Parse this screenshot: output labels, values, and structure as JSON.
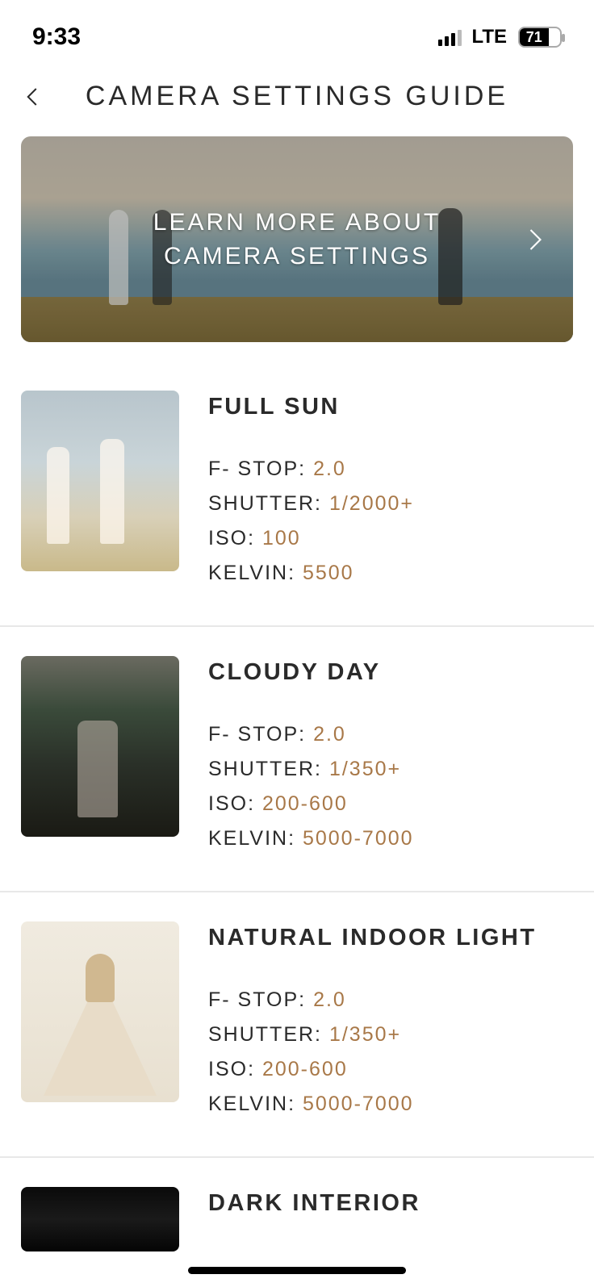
{
  "status": {
    "time": "9:33",
    "network": "LTE",
    "battery": "71"
  },
  "header": {
    "title": "CAMERA SETTINGS GUIDE"
  },
  "hero": {
    "line1": "LEARN MORE ABOUT",
    "line2": "CAMERA SETTINGS"
  },
  "specLabels": {
    "fstop": "F- STOP: ",
    "shutter": "SHUTTER: ",
    "iso": "ISO: ",
    "kelvin": "KELVIN: "
  },
  "entries": [
    {
      "title": "FULL SUN",
      "fstop": "2.0",
      "shutter": "1/2000+",
      "iso": "100",
      "kelvin": "5500"
    },
    {
      "title": "CLOUDY DAY",
      "fstop": "2.0",
      "shutter": "1/350+",
      "iso": "200-600",
      "kelvin": "5000-7000"
    },
    {
      "title": "NATURAL INDOOR LIGHT",
      "fstop": "2.0",
      "shutter": "1/350+",
      "iso": "200-600",
      "kelvin": "5000-7000"
    },
    {
      "title": "DARK INTERIOR"
    }
  ]
}
